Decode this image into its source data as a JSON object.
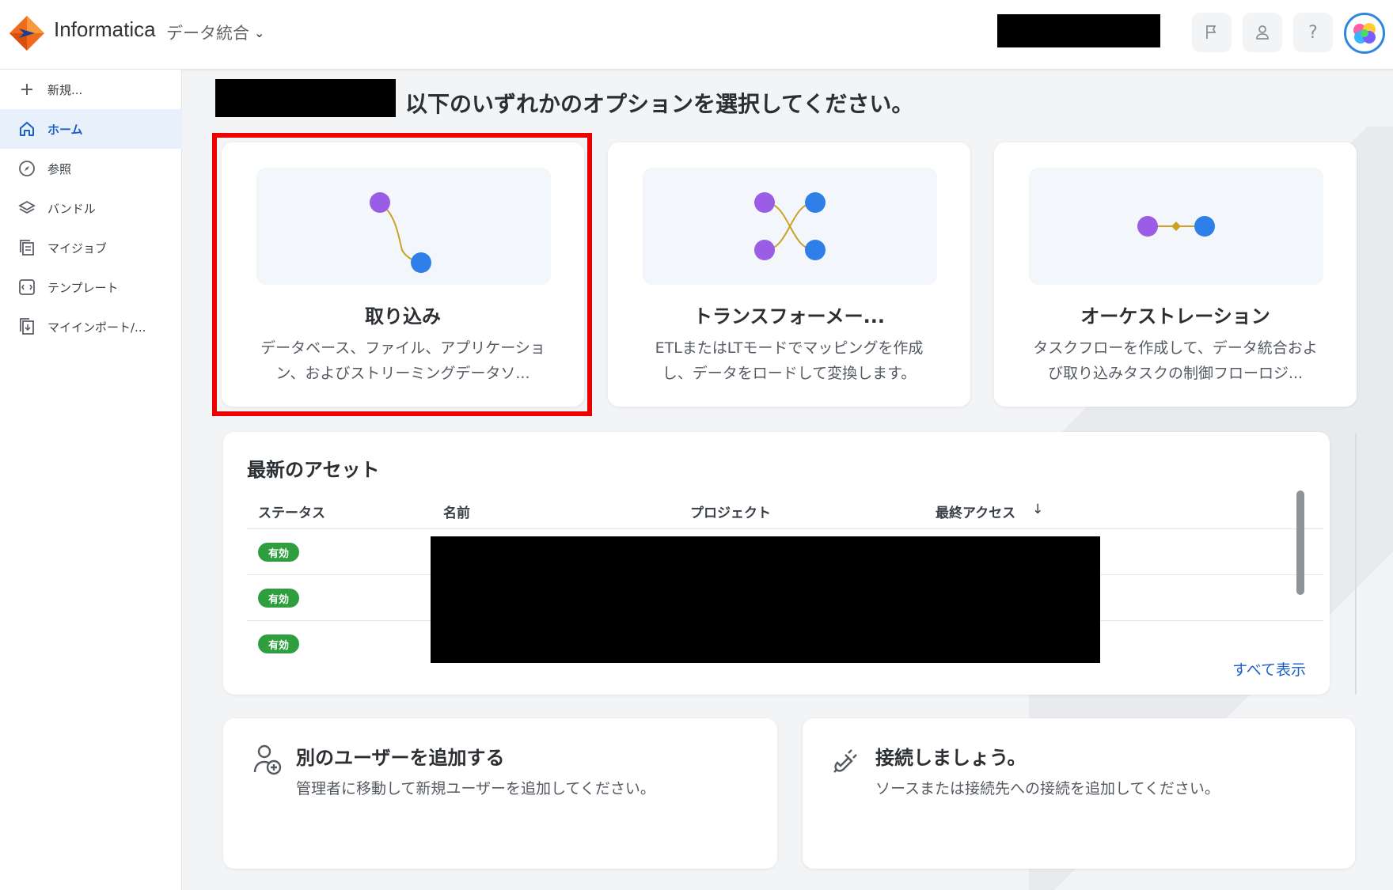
{
  "header": {
    "brand": "Informatica",
    "app_name": "データ統合",
    "avatar_alt": "user-avatar"
  },
  "sidebar": {
    "items": [
      {
        "label": "新規...",
        "icon": "plus-icon",
        "active": false
      },
      {
        "label": "ホーム",
        "icon": "home-icon",
        "active": true
      },
      {
        "label": "参照",
        "icon": "compass-icon",
        "active": false
      },
      {
        "label": "バンドル",
        "icon": "layers-icon",
        "active": false
      },
      {
        "label": "マイジョブ",
        "icon": "jobs-icon",
        "active": false
      },
      {
        "label": "テンプレート",
        "icon": "template-icon",
        "active": false
      },
      {
        "label": "マイインポート/...",
        "icon": "import-icon",
        "active": false
      }
    ]
  },
  "main": {
    "heading": "以下のいずれかのオプションを選択してください。",
    "options": [
      {
        "title": "取り込み",
        "desc": "データベース、ファイル、アプリケーション、およびストリーミングデータソ..."
      },
      {
        "title": "トランスフォーメー...",
        "desc": "ETLまたはLTモードでマッピングを作成し、データをロードして変換します。"
      },
      {
        "title": "オーケストレーション",
        "desc": "タスクフローを作成して、データ統合および取り込みタスクの制御フローロジ..."
      }
    ],
    "assets": {
      "title": "最新のアセット",
      "columns": [
        "ステータス",
        "名前",
        "プロジェクト",
        "最終アクセス"
      ],
      "sort_indicator": "↓",
      "rows": [
        {
          "status": "有効"
        },
        {
          "status": "有効"
        },
        {
          "status": "有効"
        }
      ],
      "view_all": "すべて表示"
    },
    "add_user": {
      "title": "別のユーザーを追加する",
      "desc": "管理者に移動して新規ユーザーを追加してください。"
    },
    "connect": {
      "title": "接続しましょう。",
      "desc": "ソースまたは接続先への接続を追加してください。"
    }
  },
  "colors": {
    "accent": "#1a5fc7",
    "highlight": "#ee0000",
    "status_active": "#2e9e3f",
    "node_purple": "#9b5de5",
    "node_blue": "#2f7fe8",
    "connector": "#c9a227"
  }
}
